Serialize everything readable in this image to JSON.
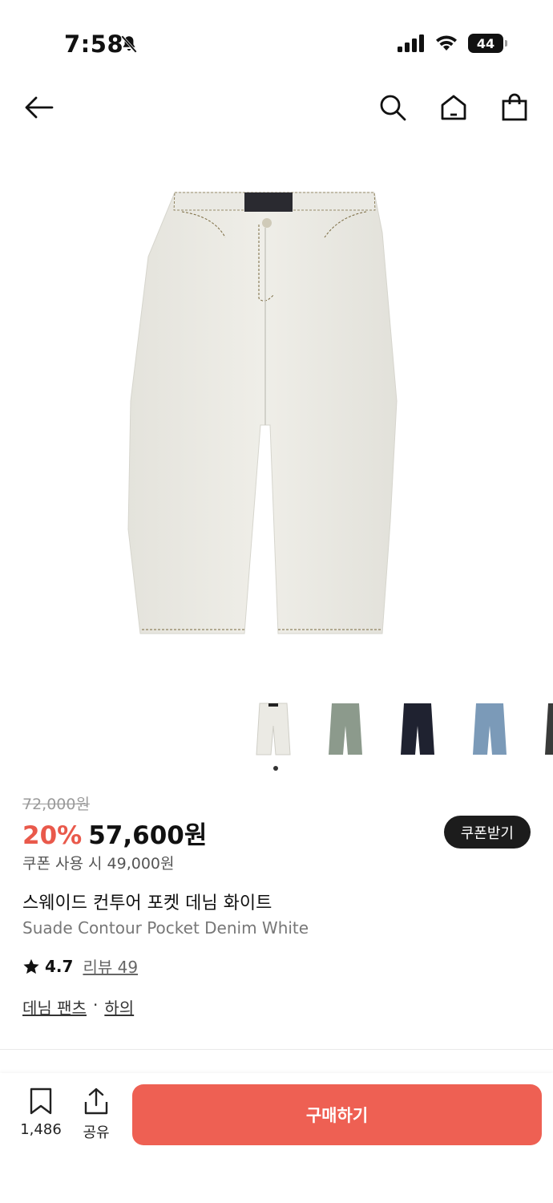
{
  "status": {
    "time": "7:58",
    "battery": "44"
  },
  "product": {
    "original_price": "72,000원",
    "discount": "20%",
    "price": "57,600원",
    "coupon_button": "쿠폰받기",
    "coupon_price": "쿠폰 사용 시 49,000원",
    "title_ko": "스웨이드 컨투어 포켓 데님 화이트",
    "title_en": "Suade Contour Pocket Denim White",
    "rating": "4.7",
    "reviews": "리뷰 49",
    "category_1": "데님 팬츠",
    "separator": "·",
    "category_2": "하의"
  },
  "thumbnails": [
    {
      "color": "#ebeae4"
    },
    {
      "color": "#8c9a8c"
    },
    {
      "color": "#1f2230"
    },
    {
      "color": "#7b9ab8"
    },
    {
      "color": "#3a3b3a"
    }
  ],
  "bottom_bar": {
    "save_count": "1,486",
    "share_label": "공유",
    "buy_label": "구매하기"
  },
  "colors": {
    "accent": "#ee6053",
    "discount": "#e9594b"
  }
}
